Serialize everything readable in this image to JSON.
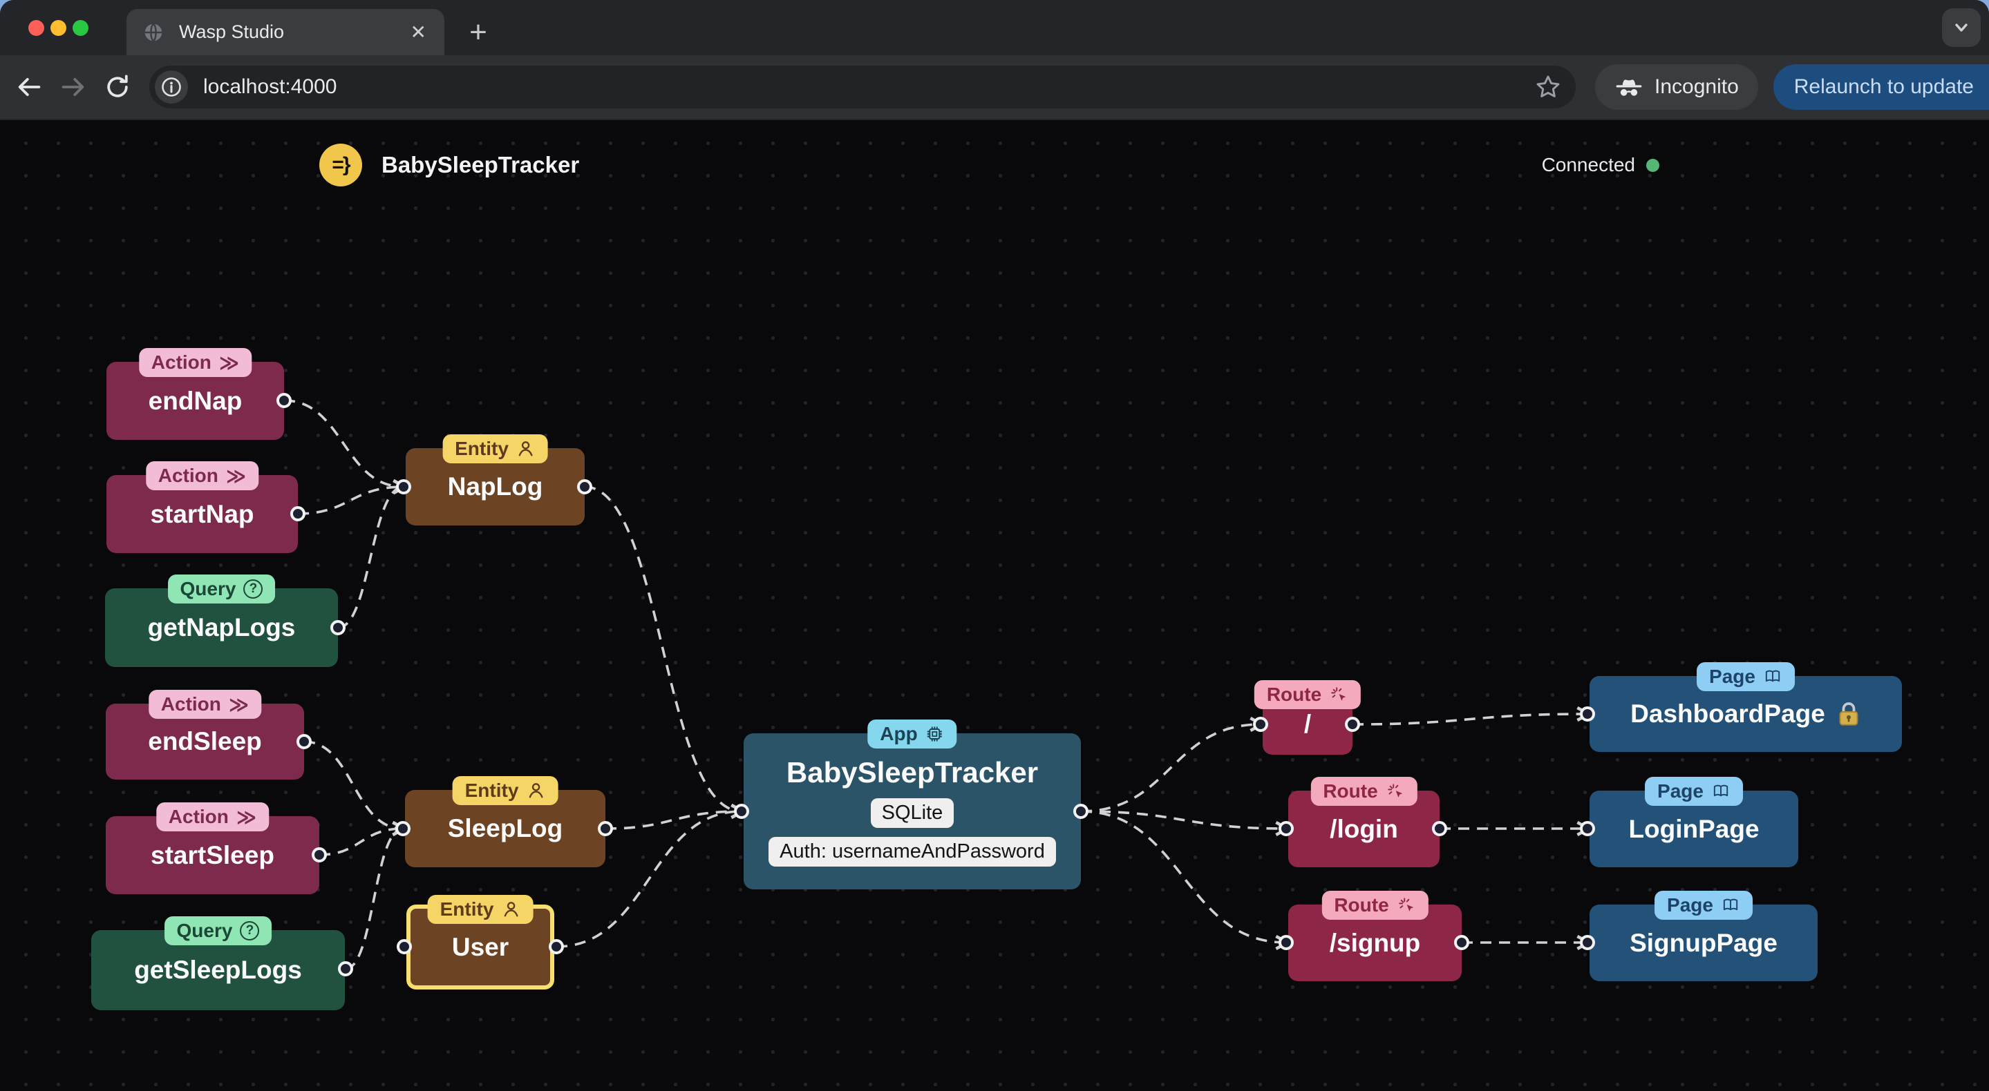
{
  "browser": {
    "tab_title": "Wasp Studio",
    "close_tab_symbol": "✕",
    "new_tab_symbol": "+",
    "url": "localhost:4000",
    "incognito_label": "Incognito",
    "relaunch_label": "Relaunch to update"
  },
  "header": {
    "logo_glyph": "=}",
    "app_title": "BabySleepTracker",
    "connection_status": "Connected"
  },
  "badge_labels": {
    "action": "Action",
    "query": "Query",
    "entity": "Entity",
    "app": "App",
    "route": "Route",
    "page": "Page"
  },
  "badge_icons": {
    "action_glyph": "≫",
    "query_glyph": "?"
  },
  "nodes": {
    "end_nap": {
      "type": "action",
      "label": "endNap"
    },
    "start_nap": {
      "type": "action",
      "label": "startNap"
    },
    "get_nap_logs": {
      "type": "query",
      "label": "getNapLogs"
    },
    "end_sleep": {
      "type": "action",
      "label": "endSleep"
    },
    "start_sleep": {
      "type": "action",
      "label": "startSleep"
    },
    "get_sleep_logs": {
      "type": "query",
      "label": "getSleepLogs"
    },
    "nap_log": {
      "type": "entity",
      "label": "NapLog"
    },
    "sleep_log": {
      "type": "entity",
      "label": "SleepLog"
    },
    "user": {
      "type": "entity",
      "label": "User",
      "selected": true
    },
    "app": {
      "type": "app",
      "label": "BabySleepTracker",
      "database": "SQLite",
      "auth": "Auth: usernameAndPassword"
    },
    "route_root": {
      "type": "route",
      "label": "/"
    },
    "route_login": {
      "type": "route",
      "label": "/login"
    },
    "route_signup": {
      "type": "route",
      "label": "/signup"
    },
    "dashboard_page": {
      "type": "page",
      "label": "DashboardPage",
      "protected": true
    },
    "login_page": {
      "type": "page",
      "label": "LoginPage"
    },
    "signup_page": {
      "type": "page",
      "label": "SignupPage"
    }
  },
  "edges": [
    {
      "from": "endNap",
      "to": "NapLog"
    },
    {
      "from": "startNap",
      "to": "NapLog"
    },
    {
      "from": "getNapLogs",
      "to": "NapLog"
    },
    {
      "from": "endSleep",
      "to": "SleepLog"
    },
    {
      "from": "startSleep",
      "to": "SleepLog"
    },
    {
      "from": "getSleepLogs",
      "to": "SleepLog"
    },
    {
      "from": "NapLog",
      "to": "BabySleepTracker"
    },
    {
      "from": "SleepLog",
      "to": "BabySleepTracker"
    },
    {
      "from": "User",
      "to": "BabySleepTracker"
    },
    {
      "from": "BabySleepTracker",
      "to": "/"
    },
    {
      "from": "BabySleepTracker",
      "to": "/login"
    },
    {
      "from": "BabySleepTracker",
      "to": "/signup"
    },
    {
      "from": "/",
      "to": "DashboardPage"
    },
    {
      "from": "/login",
      "to": "LoginPage"
    },
    {
      "from": "/signup",
      "to": "SignupPage"
    }
  ],
  "colors": {
    "canvas_bg": "#09090b",
    "edge": "#cfd1d6",
    "action_bg": "#7e2a4d",
    "action_badge": "#f3bcd6",
    "query_bg": "#20523f",
    "query_badge": "#8fe6b4",
    "entity_bg": "#6d4423",
    "entity_badge": "#f4d566",
    "app_bg": "#2b5469",
    "app_badge": "#84d7ec",
    "route_bg": "#8e2647",
    "route_badge": "#f4aabc",
    "page_bg": "#235177",
    "page_badge": "#8ecdf4",
    "selected_border": "#f7df6f",
    "connected_dot": "#57b576",
    "relaunch_bg": "#1d4d7e",
    "wasp_logo_bg": "#f0c64b"
  }
}
